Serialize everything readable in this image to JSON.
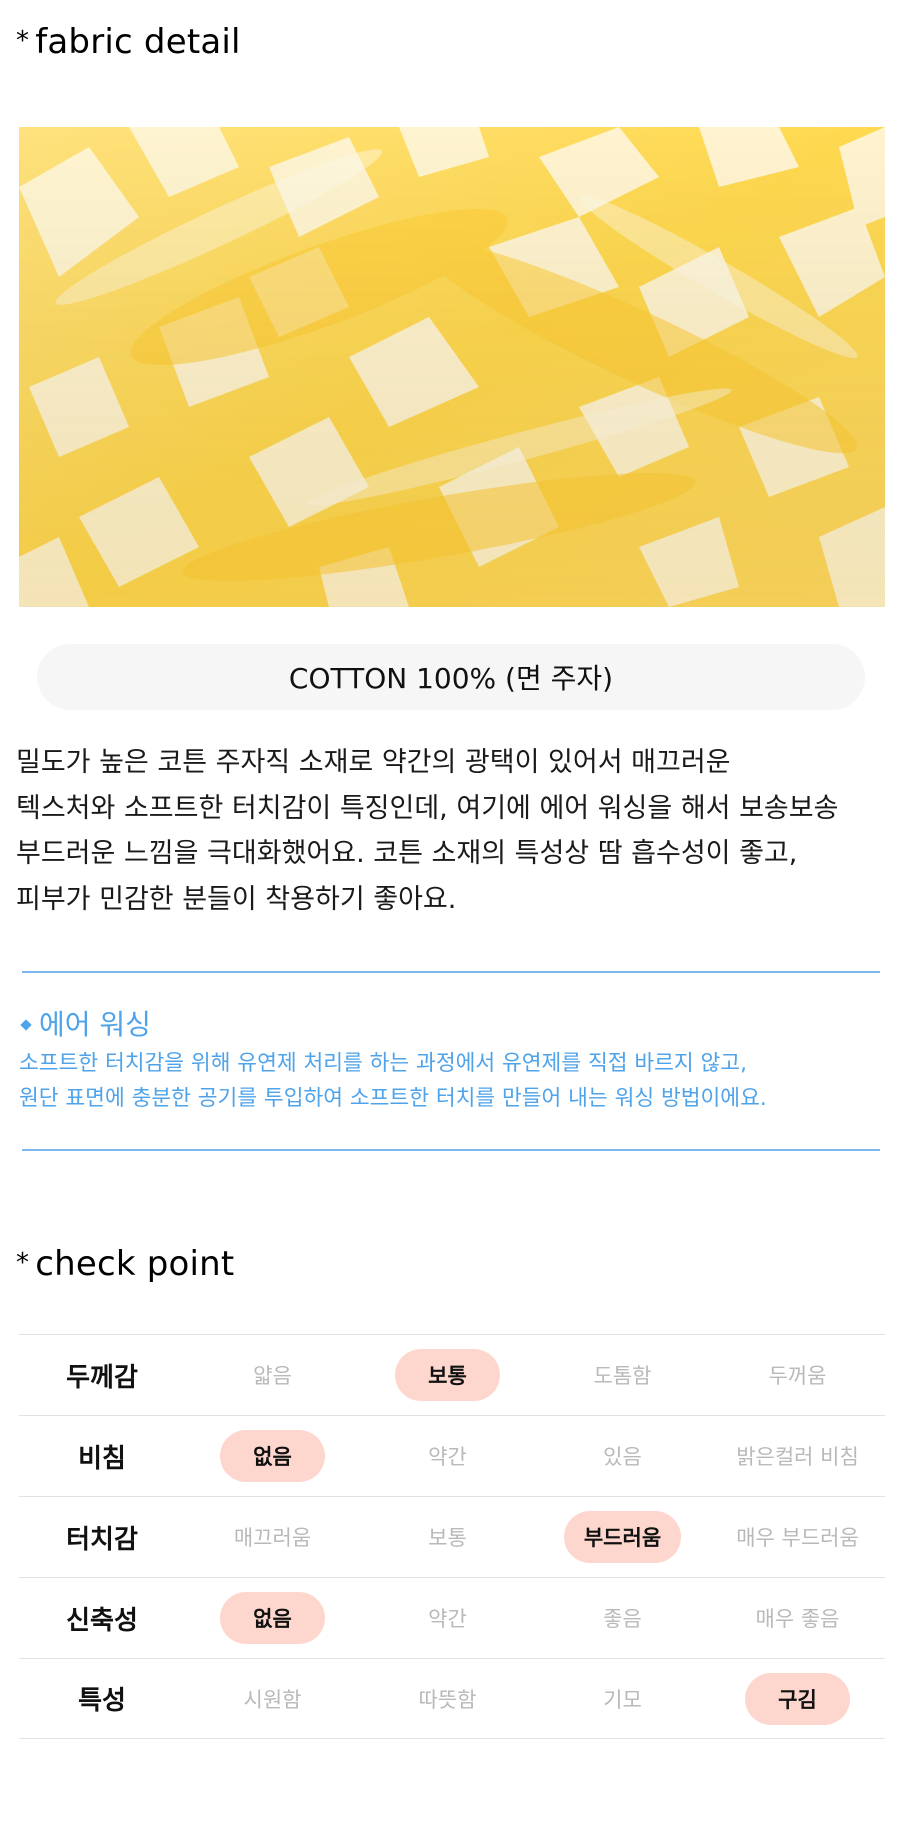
{
  "fabric_section": {
    "star": "*",
    "title": "fabric detail",
    "photo_alt": "fabric-photo",
    "material": "COTTON 100% (면 주자)",
    "description": "밀도가 높은 코튼 주자직 소재로 약간의 광택이 있어서 매끄러운\n텍스처와 소프트한 터치감이 특징인데, 여기에 에어 워싱을 해서 보송보송\n부드러운 느낌을 극대화했어요. 코튼 소재의 특성상 땀 흡수성이 좋고,\n피부가 민감한 분들이 착용하기 좋아요."
  },
  "air_washing": {
    "heading": "에어 워싱",
    "text": "소프트한 터치감을 위해 유연제 처리를 하는 과정에서 유연제를 직접 바르지 않고,\n원단 표면에 충분한 공기를 투입하여 소프트한 터치를 만들어 내는 워싱 방법이에요.",
    "color": "#4ea3ea"
  },
  "check_section": {
    "star": "*",
    "title": "check point",
    "rows": [
      {
        "label": "두께감",
        "options": [
          "얇음",
          "보통",
          "도톰함",
          "두꺼움"
        ],
        "selected": 1
      },
      {
        "label": "비침",
        "options": [
          "없음",
          "약간",
          "있음",
          "밝은컬러 비침"
        ],
        "selected": 0
      },
      {
        "label": "터치감",
        "options": [
          "매끄러움",
          "보통",
          "부드러움",
          "매우 부드러움"
        ],
        "selected": 2
      },
      {
        "label": "신축성",
        "options": [
          "없음",
          "약간",
          "좋음",
          "매우 좋음"
        ],
        "selected": 0
      },
      {
        "label": "특성",
        "options": [
          "시원함",
          "따뜻함",
          "기모",
          "구김"
        ],
        "selected": 3
      }
    ],
    "highlight_color": "#fdd7cd"
  }
}
